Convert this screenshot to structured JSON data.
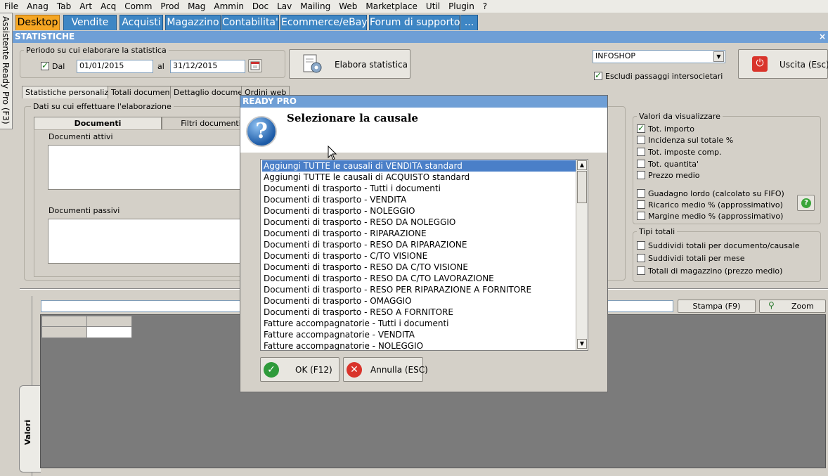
{
  "menubar": [
    "File",
    "Anag",
    "Tab",
    "Art",
    "Acq",
    "Comm",
    "Prod",
    "Mag",
    "Ammin",
    "Doc",
    "Lav",
    "Mailing",
    "Web",
    "Marketplace",
    "Util",
    "Plugin",
    "?"
  ],
  "assistant_label": "Assistente Ready Pro (F3)",
  "main_tabs": [
    "Desktop",
    "Vendite",
    "Acquisti",
    "Magazzino",
    "Contabilita'",
    "Ecommerce/eBay",
    "Forum di supporto",
    "..."
  ],
  "window_title": "STATISTICHE",
  "close_glyph": "×",
  "period": {
    "group_label": "Periodo su cui elaborare la statistica",
    "dal_label": "Dal",
    "dal_checked": true,
    "dal_value": "01/01/2015",
    "al_label": "al",
    "al_value": "31/12/2015"
  },
  "elabora_button": "Elabora statistica",
  "company_select": "INFOSHOP",
  "escludi_label": "Escludi passaggi intersocietari",
  "escludi_checked": true,
  "uscita_button": "Uscita (Esc)",
  "sub_tabs": [
    "Statistiche personalizzate",
    "Totali documenti",
    "Dettaglio documenti",
    "Ordini web"
  ],
  "dati_group_label": "Dati su cui effettuare l'elaborazione",
  "inner_tabs": [
    "Documenti",
    "Filtri documenti"
  ],
  "documenti_attivi_label": "Documenti attivi",
  "documenti_passivi_label": "Documenti passivi",
  "valori": {
    "group_label": "Valori da visualizzare",
    "options": [
      {
        "label": "Tot. importo",
        "checked": true
      },
      {
        "label": "Incidenza sul totale %",
        "checked": false
      },
      {
        "label": "Tot. imposte comp.",
        "checked": false
      },
      {
        "label": "Tot. quantita'",
        "checked": false
      },
      {
        "label": "Prezzo medio",
        "checked": false
      },
      {
        "label": "Guadagno lordo (calcolato su FIFO)",
        "checked": false
      },
      {
        "label": "Ricarico medio % (approssimativo)",
        "checked": false
      },
      {
        "label": "Margine medio % (approssimativo)",
        "checked": false
      }
    ]
  },
  "tipi_totali": {
    "group_label": "Tipi totali",
    "options": [
      {
        "label": "Suddividi totali per documento/causale",
        "checked": false
      },
      {
        "label": "Suddividi totali per mese",
        "checked": false
      },
      {
        "label": "Totali di magazzino (prezzo medio)",
        "checked": false
      }
    ]
  },
  "stampa_button": "Stampa (F9)",
  "zoom_button": "Zoom",
  "valori_side_tab": "Valori",
  "dialog": {
    "title": "READY PRO",
    "heading": "Selezionare la causale",
    "selected_index": 0,
    "items": [
      "Aggiungi TUTTE le causali di VENDITA standard",
      "Aggiungi TUTTE le causali di ACQUISTO standard",
      "Documenti di trasporto - Tutti i documenti",
      "Documenti di trasporto - VENDITA",
      "Documenti di trasporto - NOLEGGIO",
      "Documenti di trasporto - RESO DA NOLEGGIO",
      "Documenti di trasporto - RIPARAZIONE",
      "Documenti di trasporto - RESO DA RIPARAZIONE",
      "Documenti di trasporto - C/TO VISIONE",
      "Documenti di trasporto - RESO DA C/TO VISIONE",
      "Documenti di trasporto - RESO DA C/TO LAVORAZIONE",
      "Documenti di trasporto - RESO PER RIPARAZIONE A FORNITORE",
      "Documenti di trasporto - OMAGGIO",
      "Documenti di trasporto - RESO A FORNITORE",
      "Fatture accompagnatorie - Tutti i documenti",
      "Fatture accompagnatorie - VENDITA",
      "Fatture accompagnatorie - NOLEGGIO"
    ],
    "ok_button": "OK (F12)",
    "cancel_button": "Annulla (ESC)"
  },
  "colors": {
    "tab_blue": "#3e86c4",
    "tab_active": "#f5a623",
    "header_blue": "#6f9fd6",
    "selection": "#4a7fc8"
  }
}
